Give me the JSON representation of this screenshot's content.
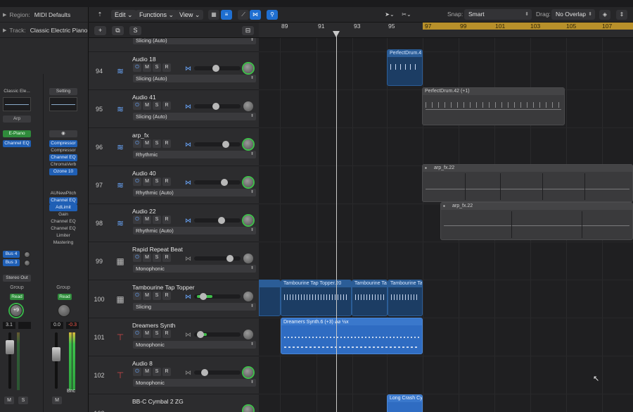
{
  "inspector": {
    "region_label": "Region:",
    "region_value": "MIDI Defaults",
    "track_label": "Track:",
    "track_value": "Classic Electric Piano",
    "strip_a": {
      "setting": "Classic Ele...",
      "arp": "Arp",
      "instrument": "E-Piano",
      "inserts": [
        "Channel EQ"
      ],
      "sends": [
        "Bus 4",
        "Bus 3"
      ],
      "output": "Stereo Out",
      "group": "Group",
      "automation": "Read",
      "pan_value": "+9",
      "volume": "3.1",
      "mute": "M",
      "solo": "S"
    },
    "strip_b": {
      "setting": "Setting",
      "inserts": [
        "Compressor",
        "Compressor",
        "Channel EQ",
        "ChromaVerb",
        "Ozone 10"
      ],
      "post_inserts": [
        "AUNewPitch",
        "Channel EQ",
        "AdLimit",
        "Gain",
        "Channel EQ",
        "Channel EQ",
        "Limiter",
        "Mastering"
      ],
      "group": "Group",
      "automation": "Read",
      "volume": "0.0",
      "peak": "-0.3",
      "bounce": "Bnc",
      "mute": "M"
    }
  },
  "toolbar": {
    "edit": "Edit",
    "functions": "Functions",
    "view": "View",
    "snap_label": "Snap:",
    "snap_value": "Smart",
    "drag_label": "Drag:",
    "drag_value": "No Overlap"
  },
  "ruler": {
    "bars": [
      "89",
      "91",
      "93",
      "95",
      "97",
      "99",
      "101",
      "103",
      "105",
      "107"
    ]
  },
  "tracks": [
    {
      "num": "",
      "name": "",
      "algo": "Slicing (Auto)"
    },
    {
      "num": "94",
      "name": "Audio 18",
      "algo": "Slicing (Auto)"
    },
    {
      "num": "95",
      "name": "Audio 41",
      "algo": "Slicing (Auto)"
    },
    {
      "num": "96",
      "name": "arp_fx",
      "algo": "Rhythmic"
    },
    {
      "num": "97",
      "name": "Audio 40",
      "algo": "Rhythmic (Auto)"
    },
    {
      "num": "98",
      "name": "Audio 22",
      "algo": "Rhythmic (Auto)"
    },
    {
      "num": "99",
      "name": "Rapid Repeat Beat",
      "algo": "Monophonic"
    },
    {
      "num": "100",
      "name": "Tambourine Tap Topper",
      "algo": "Slicing"
    },
    {
      "num": "101",
      "name": "Dreamers Synth",
      "algo": "Monophonic"
    },
    {
      "num": "102",
      "name": "Audio 8",
      "algo": "Monophonic"
    },
    {
      "num": "103",
      "name": "BB-C Cymbal 2 ZG",
      "algo": ""
    }
  ],
  "track_buttons": {
    "mute": "M",
    "solo": "S",
    "record": "R"
  },
  "regions": {
    "perfect_drum_4": "PerfectDrum.4",
    "perfect_drum_42": "PerfectDrum.42 (+1)",
    "arp_fx_22a": "arp_fx.22",
    "arp_fx_22b": "arp_fx.22",
    "tambourine_1": "Tambourine Tap Topper.20",
    "tambourine_2": "Tambourine Ta",
    "tambourine_3": "Tambourine Ta",
    "dreamers": "Dreamers Synth.6 (+3)  ⌀⌀  ½x",
    "long_crash": "Long Crash Cy"
  },
  "colors": {
    "accent_blue": "#1f6fd1",
    "cycle": "#b8902a",
    "meter_green": "#3bbf4a"
  }
}
